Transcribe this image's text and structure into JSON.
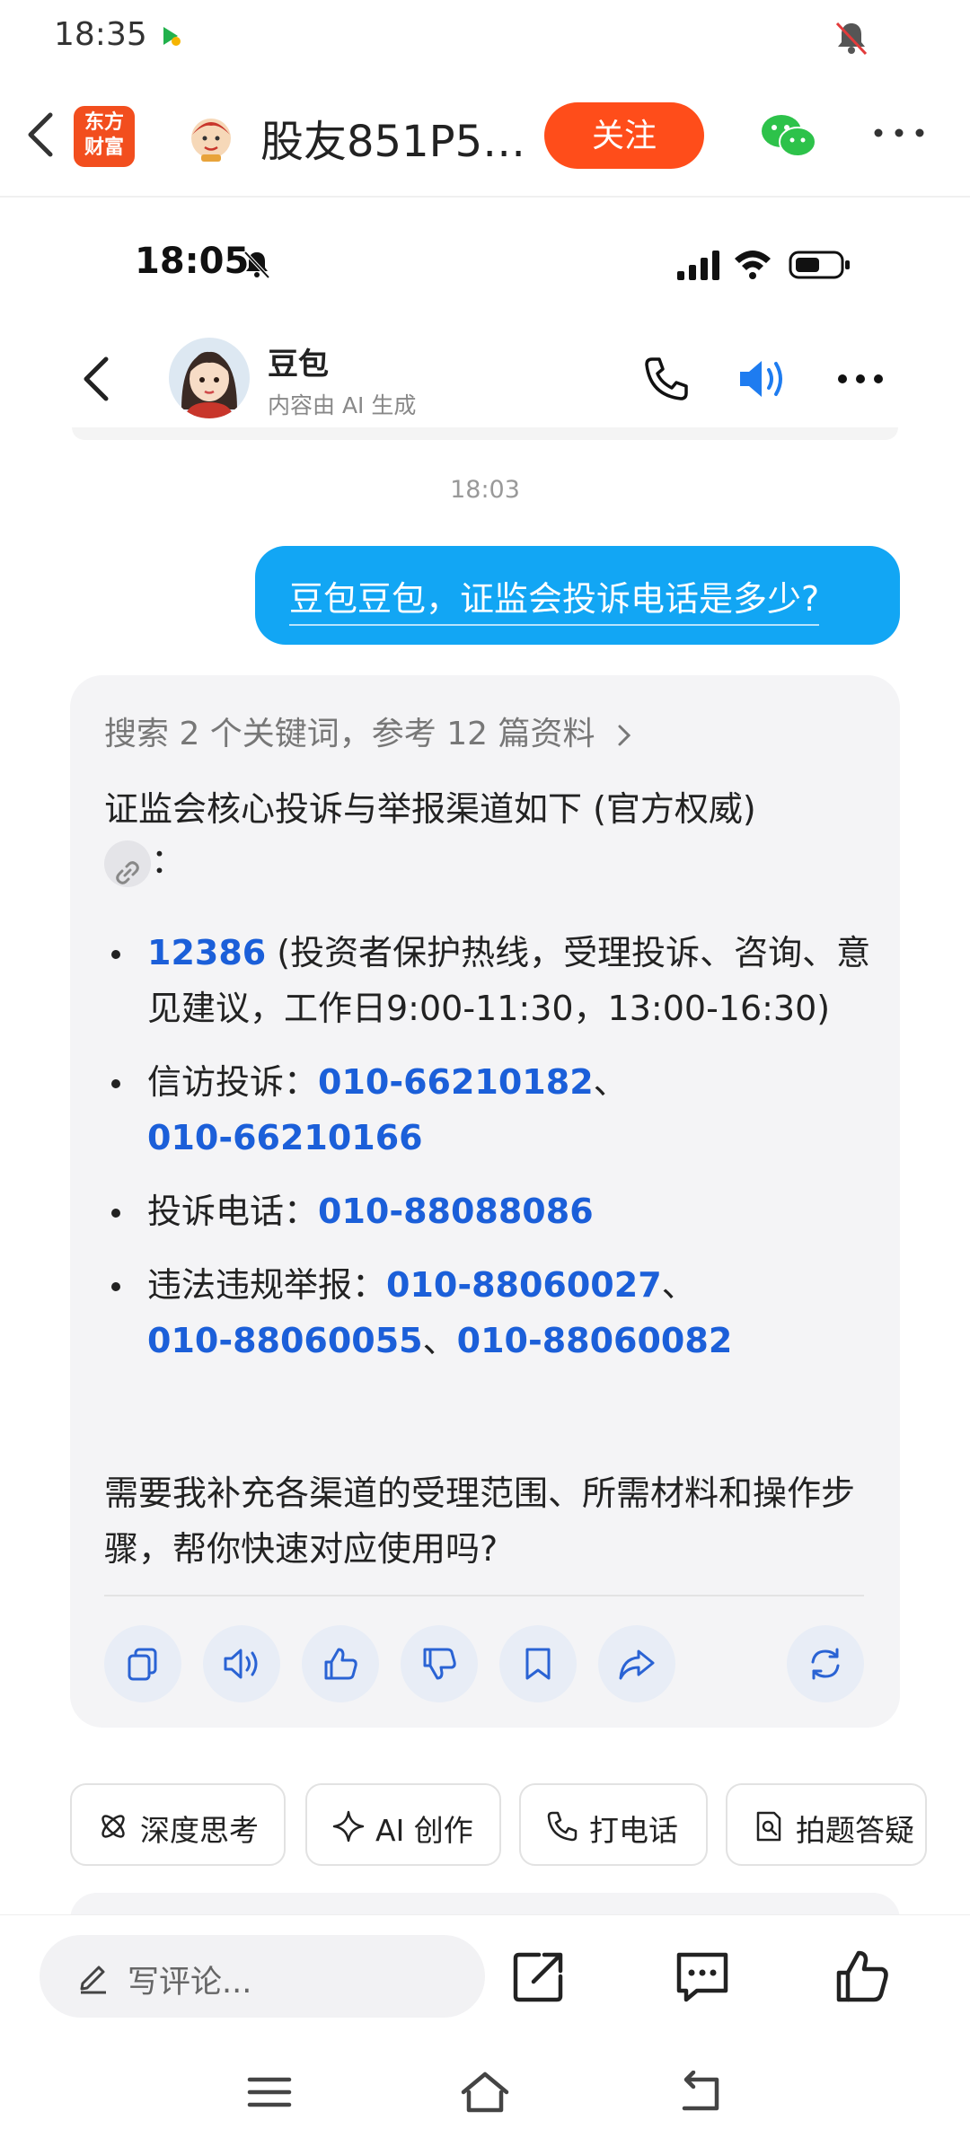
{
  "outer_status": {
    "time": "18:35"
  },
  "app_header": {
    "logo_line1": "东方",
    "logo_line2": "财富",
    "title": "股友851P5…",
    "follow_label": "关注"
  },
  "inner_status": {
    "time": "18:05"
  },
  "chat_header": {
    "name": "豆包",
    "subtitle": "内容由 AI 生成"
  },
  "timestamp": "18:03",
  "user_message": "豆包豆包，证监会投诉电话是多少?",
  "ai_reply": {
    "search_summary": "搜索 2 个关键词，参考 12 篇资料",
    "intro": "证监会核心投诉与举报渠道如下 (官方权威)",
    "intro_colon": "：",
    "items": [
      {
        "number": "12386",
        "text": " (投资者保护热线，受理投诉、咨询、意见建议，工作日9:00-11:30，13:00-16:30)"
      },
      {
        "label": "信访投诉：",
        "num1": "010-66210182",
        "sep": "、",
        "num2": "010-66210166"
      },
      {
        "label": "投诉电话：",
        "num1": "010-88088086"
      },
      {
        "label": "违法违规举报：",
        "num1": "010-88060027",
        "sep1": "、",
        "num2": "010-88060055",
        "sep2": "、",
        "num3": "010-88060082"
      }
    ],
    "closing": "需要我补充各渠道的受理范围、所需材料和操作步骤，帮你快速对应使用吗?"
  },
  "quick_chips": [
    "深度思考",
    "AI 创作",
    "打电话",
    "拍题答疑"
  ],
  "bottom_bar": {
    "comment_placeholder": "写评论..."
  },
  "colors": {
    "accent_blue": "#12a6f4",
    "link_blue": "#1b5fd9",
    "follow_orange": "#ff4d1a",
    "wechat_green": "#2dc24a"
  }
}
